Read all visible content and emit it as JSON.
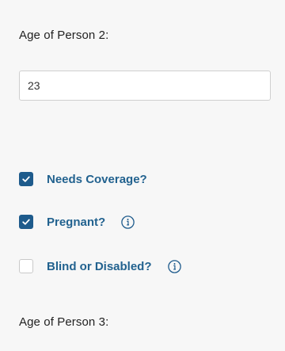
{
  "person2": {
    "label": "Age of Person 2:",
    "age_value": "23"
  },
  "options": {
    "needs_coverage": {
      "label": "Needs Coverage?",
      "checked": true
    },
    "pregnant": {
      "label": "Pregnant?",
      "checked": true,
      "icon": "info-icon"
    },
    "blind_or_disabled": {
      "label": "Blind or Disabled?",
      "checked": false,
      "icon": "info-icon"
    }
  },
  "person3": {
    "label": "Age of Person 3:"
  },
  "colors": {
    "accent": "#1e5b8c",
    "label_text": "#22628f",
    "background": "#f7f7f7"
  }
}
